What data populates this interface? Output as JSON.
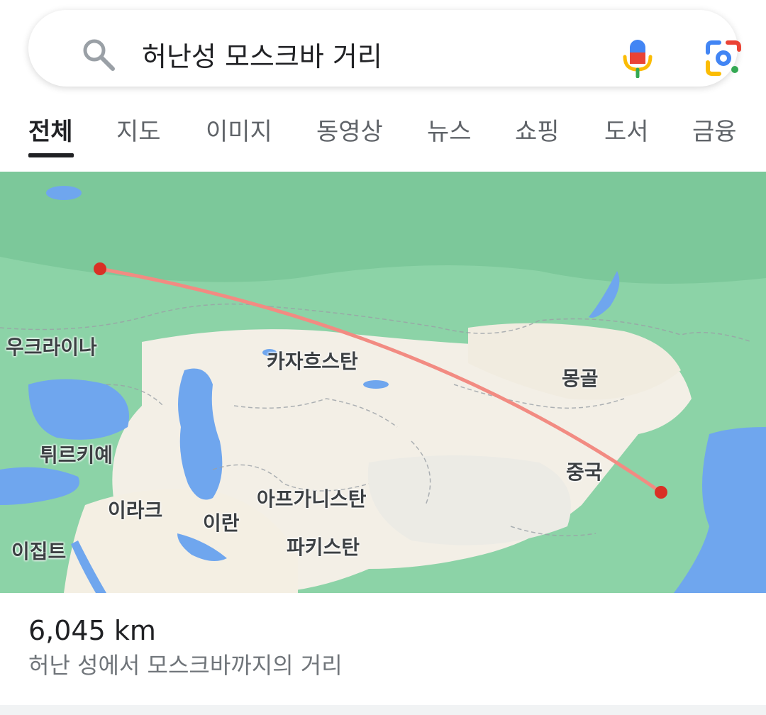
{
  "search": {
    "query": "허난성 모스크바 거리",
    "icons": [
      "search-icon",
      "mic-icon",
      "lens-icon"
    ]
  },
  "tabs": [
    {
      "label": "전체",
      "active": true
    },
    {
      "label": "지도",
      "active": false
    },
    {
      "label": "이미지",
      "active": false
    },
    {
      "label": "동영상",
      "active": false
    },
    {
      "label": "뉴스",
      "active": false
    },
    {
      "label": "쇼핑",
      "active": false
    },
    {
      "label": "도서",
      "active": false
    },
    {
      "label": "금융",
      "active": false
    }
  ],
  "map": {
    "labels": {
      "ukraine": "우크라이나",
      "kazakhstan": "카자흐스탄",
      "mongolia": "몽골",
      "turkey": "튀르키예",
      "china": "중국",
      "iraq": "이라크",
      "iran": "이란",
      "afghanistan": "아프가니스탄",
      "egypt": "이집트",
      "pakistan": "파키스탄"
    },
    "route_color": "#f28b82",
    "marker_color": "#d93025"
  },
  "result": {
    "distance": "6,045 km",
    "description": "허난 성에서 모스크바까지의 거리"
  },
  "colors": {
    "accent_underline": "#202124",
    "land_green": "#8cd3a7",
    "land_desert": "#f3efe6",
    "water": "#6fa6ee"
  }
}
